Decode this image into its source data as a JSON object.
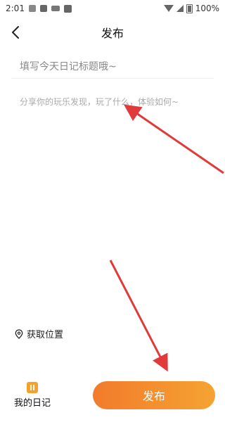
{
  "status": {
    "time": "2:01",
    "battery": "100%"
  },
  "nav": {
    "title": "发布"
  },
  "form": {
    "title_placeholder": "填写今天日记标题哦~",
    "content_placeholder": "分享你的玩乐发现，玩了什么，体验如何~"
  },
  "location": {
    "label": "获取位置"
  },
  "bottom": {
    "diary_label": "我的日记",
    "publish_label": "发布"
  },
  "colors": {
    "accent_start": "#F27B2B",
    "accent_end": "#F5A332",
    "arrow": "#E03A3A"
  }
}
